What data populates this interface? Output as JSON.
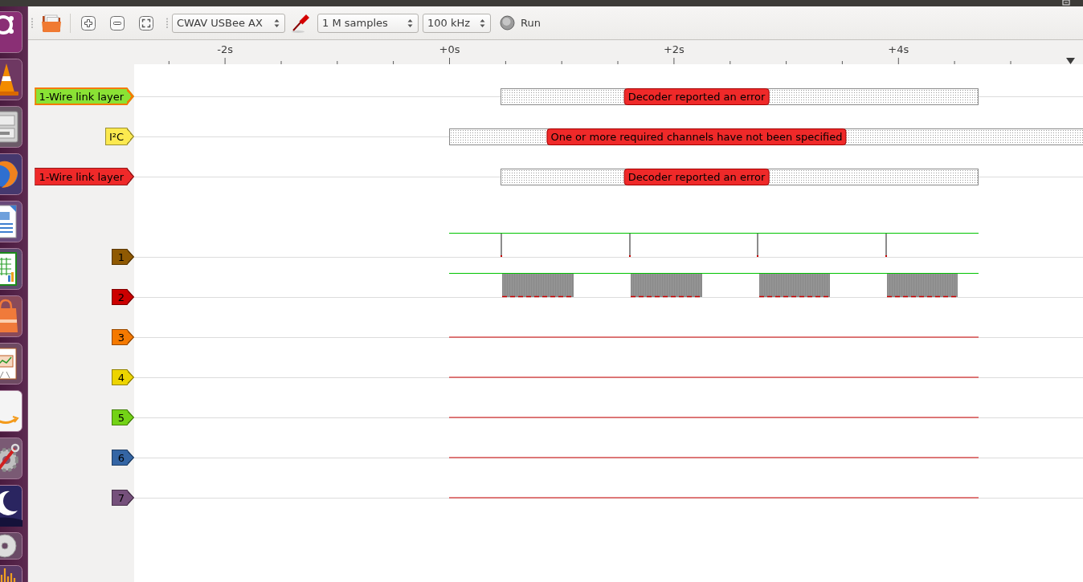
{
  "toolbar": {
    "device": "CWAV USBee AX",
    "sample_count": "1 M samples",
    "sample_rate": "100 kHz",
    "run_button": "Run"
  },
  "ruler": {
    "labels": [
      "-2s",
      "+0s",
      "+2s",
      "+4s"
    ]
  },
  "decoders": [
    {
      "label": "1-Wire link layer",
      "color": "#8ae234",
      "selected": true,
      "annotation": {
        "kind": "bounded",
        "text": "Decoder reported an error"
      }
    },
    {
      "label": "I²C",
      "color": "#fce94f",
      "selected": false,
      "annotation": {
        "kind": "unbounded",
        "text": "One or more required channels have not been specified"
      }
    },
    {
      "label": "1-Wire link layer",
      "color": "#ef2929",
      "selected": false,
      "annotation": {
        "kind": "bounded",
        "text": "Decoder reported an error"
      }
    }
  ],
  "channels": [
    {
      "label": "1",
      "color": "#8f5902",
      "selected": false,
      "kind": "pulses"
    },
    {
      "label": "2",
      "color": "#cc0000",
      "selected": false,
      "kind": "bursts"
    },
    {
      "label": "3",
      "color": "#f57900",
      "selected": false,
      "kind": "low"
    },
    {
      "label": "4",
      "color": "#edd400",
      "selected": false,
      "kind": "low"
    },
    {
      "label": "5",
      "color": "#73d216",
      "selected": false,
      "kind": "low"
    },
    {
      "label": "6",
      "color": "#3465a4",
      "selected": false,
      "kind": "low"
    },
    {
      "label": "7",
      "color": "#75507b",
      "selected": false,
      "kind": "low"
    }
  ]
}
